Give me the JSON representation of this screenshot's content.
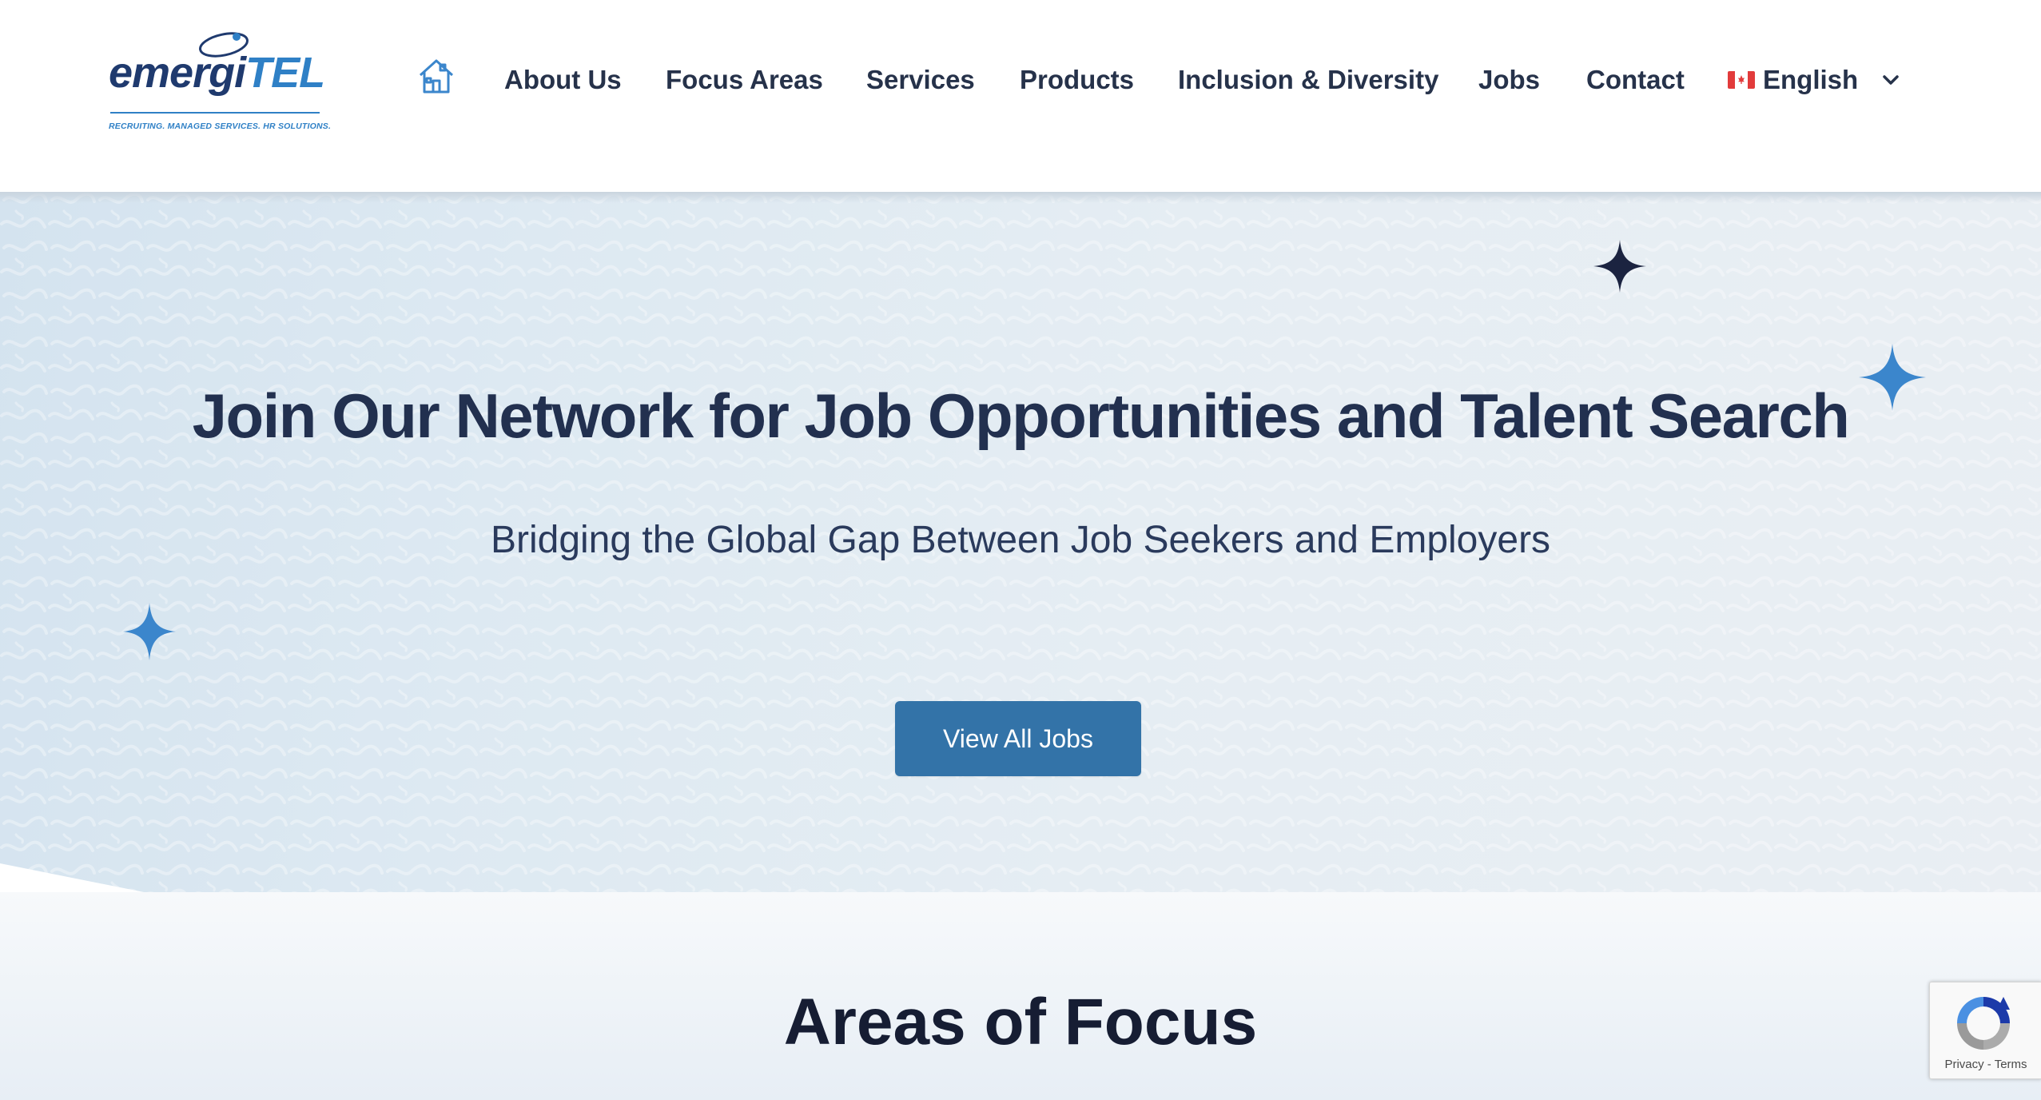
{
  "brand": {
    "logo_word_a": "emergi",
    "logo_word_b": "TEL",
    "tagline": "RECRUITING. MANAGED SERVICES. HR SOLUTIONS."
  },
  "nav": {
    "home_icon": "home-icon",
    "items": [
      {
        "label": "About Us"
      },
      {
        "label": "Focus Areas"
      },
      {
        "label": "Services"
      },
      {
        "label": "Products"
      },
      {
        "label": "Inclusion & Diversity"
      },
      {
        "label": "Jobs"
      },
      {
        "label": "Contact"
      }
    ],
    "language": {
      "flag_icon": "canada-flag-icon",
      "label": "English",
      "dropdown_icon": "chevron-down-icon"
    }
  },
  "hero": {
    "title": "Join Our Network for Job Opportunities and Talent Search",
    "subtitle": "Bridging the Global Gap Between Job Seekers and Employers",
    "cta_label": "View All Jobs",
    "decorations": [
      "sparkle-icon",
      "sparkle-icon",
      "sparkle-icon"
    ]
  },
  "focus": {
    "title": "Areas of Focus"
  },
  "recaptcha": {
    "privacy": "Privacy",
    "separator": " - ",
    "terms": "Terms"
  },
  "colors": {
    "brand_dark": "#1f3a6e",
    "brand_blue": "#2f80c6",
    "nav_text": "#26324a",
    "hero_title": "#22304f",
    "button": "#3373a8",
    "sparkle_dark": "#1b2340",
    "sparkle_blue": "#3b86cc"
  }
}
